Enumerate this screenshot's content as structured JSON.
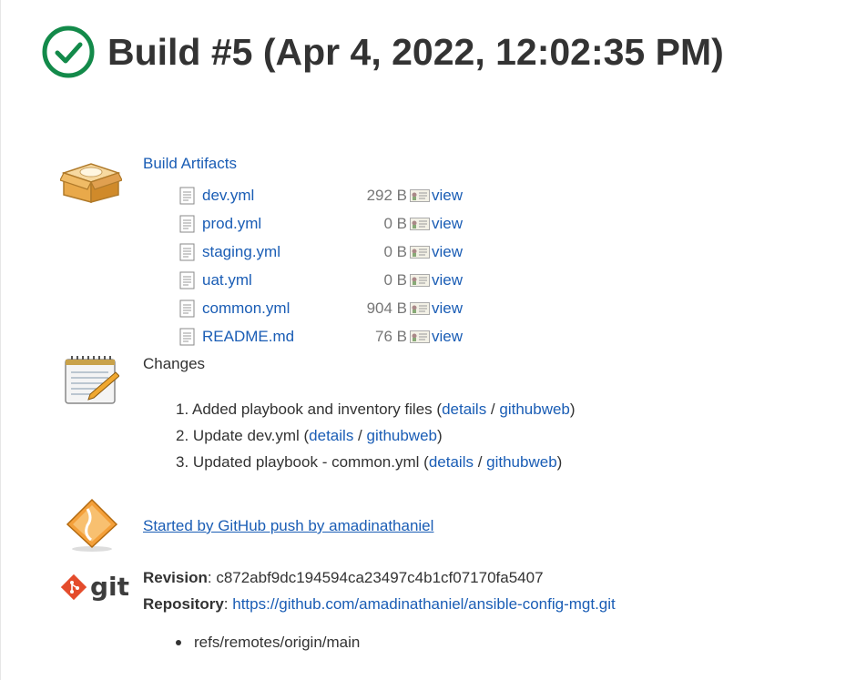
{
  "header": {
    "title": "Build #5 (Apr 4, 2022, 12:02:35 PM)",
    "status_icon": "success-check-icon",
    "status_color": "#138a4a"
  },
  "artifacts": {
    "title": "Build Artifacts",
    "files": [
      {
        "name": "dev.yml",
        "size": "292 B",
        "view_label": "view"
      },
      {
        "name": "prod.yml",
        "size": "0 B",
        "view_label": "view"
      },
      {
        "name": "staging.yml",
        "size": "0 B",
        "view_label": "view"
      },
      {
        "name": "uat.yml",
        "size": "0 B",
        "view_label": "view"
      },
      {
        "name": "common.yml",
        "size": "904 B",
        "view_label": "view"
      },
      {
        "name": "README.md",
        "size": "76 B",
        "view_label": "view"
      }
    ]
  },
  "changes": {
    "title": "Changes",
    "items": [
      {
        "num": "1.",
        "text": "Added playbook and inventory files",
        "details": "details",
        "web": "githubweb"
      },
      {
        "num": "2.",
        "text": "Update dev.yml",
        "details": "details",
        "web": "githubweb"
      },
      {
        "num": "3.",
        "text": "Updated playbook - common.yml",
        "details": "details",
        "web": "githubweb"
      }
    ]
  },
  "cause": {
    "text": "Started by GitHub push by amadinathaniel"
  },
  "git": {
    "logo_text": "git",
    "revision_label": "Revision",
    "revision": "c872abf9dc194594ca23497c4b1cf07170fa5407",
    "repository_label": "Repository",
    "repository": "https://github.com/amadinathaniel/ansible-config-mgt.git",
    "branches": [
      "refs/remotes/origin/main"
    ]
  },
  "colors": {
    "link": "#1a5db5",
    "text": "#333333",
    "muted": "#777777"
  }
}
